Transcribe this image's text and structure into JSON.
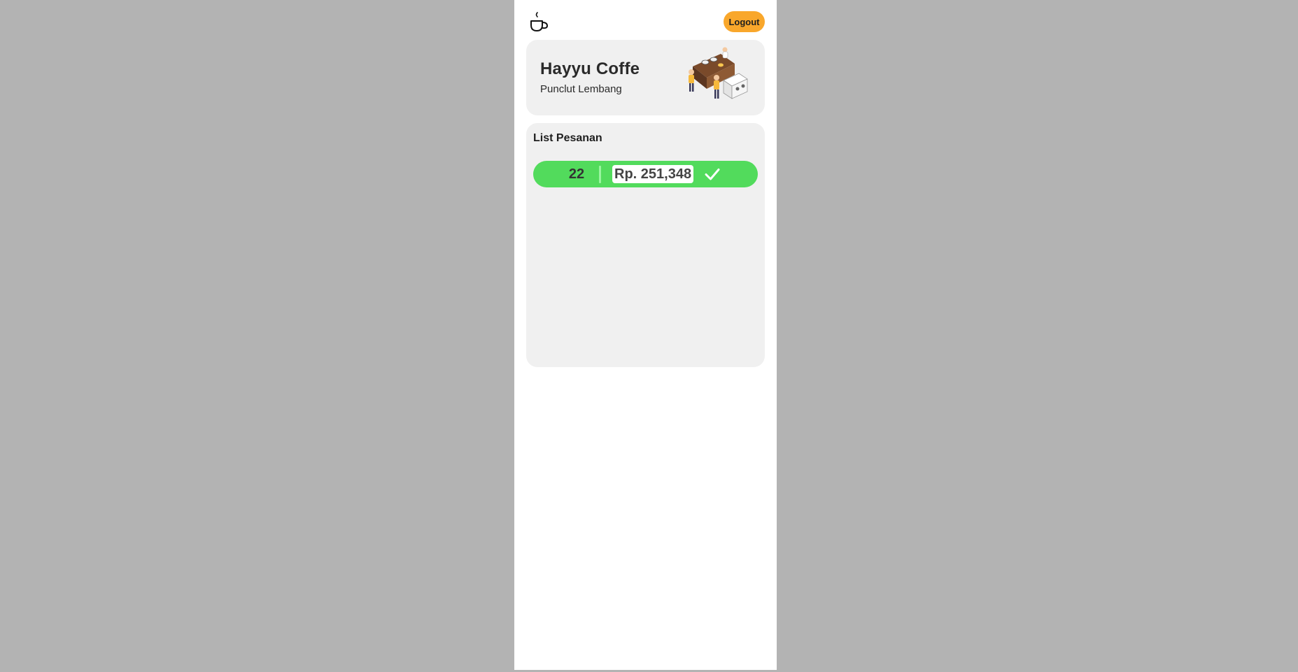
{
  "header": {
    "logo_icon": "coffee-cup-icon",
    "logout_label": "Logout",
    "logout_color": "#f9a72b"
  },
  "shop": {
    "name": "Hayyu Coffe",
    "location": "Punclut Lembang",
    "illustration": "barista-illustration"
  },
  "orders": {
    "title": "List Pesanan",
    "items": [
      {
        "number": "22",
        "total": "Rp. 251,348",
        "status_icon": "check-icon",
        "status_color": "#52db5c"
      }
    ]
  }
}
